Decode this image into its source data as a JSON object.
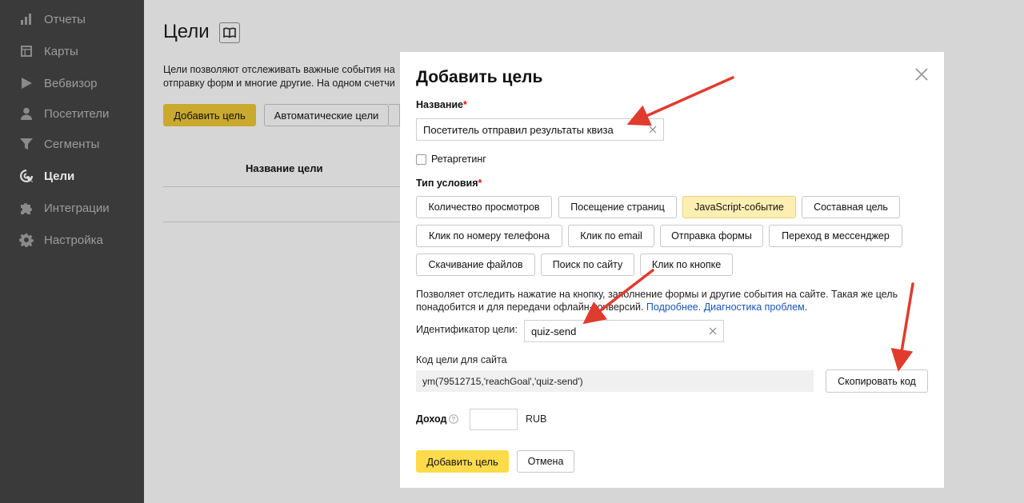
{
  "sidebar": {
    "items": [
      {
        "label": "Отчеты",
        "icon": "bar-chart-icon"
      },
      {
        "label": "Карты",
        "icon": "map-layout-icon"
      },
      {
        "label": "Вебвизор",
        "icon": "play-icon"
      },
      {
        "label": "Посетители",
        "icon": "user-icon"
      },
      {
        "label": "Сегменты",
        "icon": "funnel-icon"
      },
      {
        "label": "Цели",
        "icon": "target-cursor-icon",
        "active": true
      },
      {
        "label": "Интеграции",
        "icon": "puzzle-icon"
      },
      {
        "label": "Настройка",
        "icon": "gear-icon"
      }
    ]
  },
  "background_page": {
    "title": "Цели",
    "description_line1": "Цели позволяют отслеживать важные события на",
    "description_line2": "отправку форм и многие другие. На одном счетчи",
    "add_goal_button": "Добавить цель",
    "auto_goals_button": "Автоматические цели",
    "table_header": "Название цели"
  },
  "modal": {
    "title": "Добавить цель",
    "name_label": "Название",
    "name_value": "Посетитель отправил результаты квиза",
    "retargeting_label": "Ретаргетинг",
    "condition_label": "Тип условия",
    "condition_types": [
      "Количество просмотров",
      "Посещение страниц",
      "JavaScript-событие",
      "Составная цель",
      "Клик по номеру телефона",
      "Клик по email",
      "Отправка формы",
      "Переход в мессенджер",
      "Скачивание файлов",
      "Поиск по сайту",
      "Клик по кнопке"
    ],
    "selected_condition": "JavaScript-событие",
    "info_text_1": "Позволяет отследить нажатие на кнопку, заполнение формы и другие события на сайте. Такая же цель",
    "info_text_2": "понадобится и для передачи офлайн-конверсий.",
    "info_link_more": "Подробнее.",
    "info_link_diagnostics": "Диагностика проблем",
    "info_end": ".",
    "goal_id_label": "Идентификатор цели:",
    "goal_id_value": "quiz-send",
    "code_label": "Код цели для сайта",
    "code_value": "ym(79512715,'reachGoal','quiz-send')",
    "copy_button": "Скопировать код",
    "income_label": "Доход",
    "currency": "RUB",
    "submit_button": "Добавить цель",
    "cancel_button": "Отмена"
  },
  "colors": {
    "accent_yellow": "#fddb4a",
    "selected_chip": "#fdefb2",
    "link": "#1a55b8",
    "annotation_arrow": "#e03c2e"
  }
}
